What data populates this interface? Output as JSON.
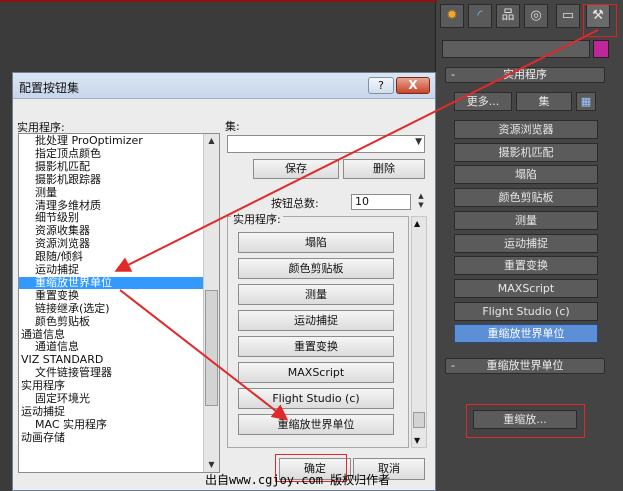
{
  "dialog": {
    "title": "配置按钮集",
    "help_label": "?",
    "close_label": "X",
    "utility_list_label": "实用程序:",
    "set_label": "集:",
    "save_label": "保存",
    "delete_label": "删除",
    "button_count_label": "按钮总数:",
    "button_count_value": "10",
    "group_label": "实用程序:",
    "ok_label": "确定",
    "cancel_label": "取消",
    "utility_list": [
      {
        "label": "批处理 ProOptimizer",
        "indent": 2
      },
      {
        "label": "指定顶点颜色",
        "indent": 2
      },
      {
        "label": "摄影机匹配",
        "indent": 2
      },
      {
        "label": "摄影机跟踪器",
        "indent": 2
      },
      {
        "label": "测量",
        "indent": 2
      },
      {
        "label": "清理多维材质",
        "indent": 2
      },
      {
        "label": "细节级别",
        "indent": 2
      },
      {
        "label": "资源收集器",
        "indent": 2
      },
      {
        "label": "资源浏览器",
        "indent": 2
      },
      {
        "label": "跟随/倾斜",
        "indent": 2
      },
      {
        "label": "运动捕捉",
        "indent": 2
      },
      {
        "label": "重缩放世界单位",
        "indent": 2,
        "selected": true
      },
      {
        "label": "重置变换",
        "indent": 2
      },
      {
        "label": "链接继承(选定)",
        "indent": 2
      },
      {
        "label": "颜色剪贴板",
        "indent": 2
      },
      {
        "label": "通道信息",
        "indent": 0
      },
      {
        "label": "通道信息",
        "indent": 2
      },
      {
        "label": "VIZ STANDARD",
        "indent": 0
      },
      {
        "label": "文件链接管理器",
        "indent": 2
      },
      {
        "label": "实用程序",
        "indent": 0
      },
      {
        "label": "固定环境光",
        "indent": 2
      },
      {
        "label": "运动捕捉",
        "indent": 0
      },
      {
        "label": "MAC 实用程序",
        "indent": 2
      },
      {
        "label": "动画存储",
        "indent": 0
      }
    ],
    "set_buttons": [
      "塌陷",
      "颜色剪贴板",
      "测量",
      "运动捕捉",
      "重置变换",
      "MAXScript",
      "Flight Studio (c)",
      "重缩放世界单位"
    ]
  },
  "panel": {
    "tab_icons": [
      "sphere-icon",
      "arc-icon",
      "hierarchy-icon",
      "motion-icon",
      "display-icon",
      "hammer-icon"
    ],
    "utilities_title": "实用程序",
    "more_label": "更多...",
    "sets_label": "集",
    "utility_buttons": [
      "资源浏览器",
      "摄影机匹配",
      "塌陷",
      "颜色剪贴板",
      "测量",
      "运动捕捉",
      "重置变换",
      "MAXScript",
      "Flight Studio (c)",
      "重缩放世界单位"
    ],
    "selected_utility": "重缩放世界单位",
    "rescale_title": "重缩放世界单位",
    "rescale_button": "重缩放..."
  },
  "watermark": "出自www.cgjoy.com 版权归作者",
  "colors": {
    "accent": "#3399ff",
    "panel_selected": "#5c8fd6",
    "annotation_red": "#e02a2a",
    "swatch": "#c0269a"
  }
}
